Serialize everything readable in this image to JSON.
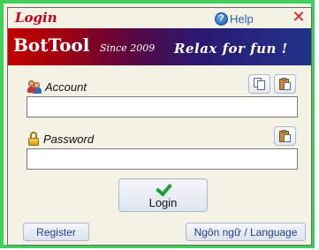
{
  "window": {
    "title": "Login",
    "help_label": "Help",
    "help_glyph": "?",
    "close_glyph": "✕"
  },
  "banner": {
    "app_name": "BotTool",
    "since": "Since 2009",
    "slogan": "Relax for fun !"
  },
  "form": {
    "account_label": "Account",
    "account_value": "",
    "password_label": "Password",
    "password_value": ""
  },
  "buttons": {
    "login_label": "Login",
    "register_label": "Register",
    "language_label": "Ngôn ngữ / Language"
  },
  "icons": {
    "account_icon": "users-icon",
    "password_icon": "lock-icon",
    "copy_icon": "copy-icon",
    "paste_icon": "paste-icon",
    "login_icon": "checkmark-icon",
    "help_icon": "help-icon",
    "close_icon": "close-icon"
  },
  "colors": {
    "window_border": "#3fcf5b",
    "title_text": "#c6001a",
    "close_icon": "#ea1c1c",
    "help_text": "#2a62b6",
    "banner_start": "#c30000",
    "banner_end": "#22338a",
    "link_text": "#1f3f8f",
    "check_icon": "#1f9e3c"
  }
}
